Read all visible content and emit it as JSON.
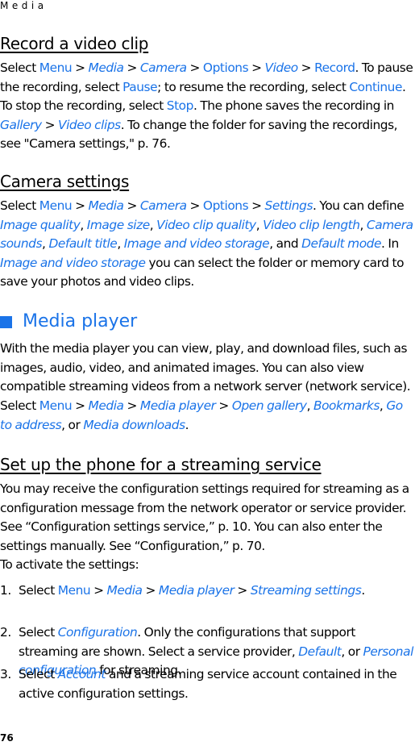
{
  "running_head": "Media",
  "page_number": "76",
  "colors": {
    "accent": "#1a73e8",
    "text": "#000000"
  },
  "sections": {
    "record": {
      "heading": "Record a video clip",
      "p1": [
        {
          "t": "Select ",
          "s": "n"
        },
        {
          "t": "Menu",
          "s": "b"
        },
        {
          "t": " > ",
          "s": "n"
        },
        {
          "t": "Media",
          "s": "i"
        },
        {
          "t": " > ",
          "s": "n"
        },
        {
          "t": "Camera",
          "s": "i"
        },
        {
          "t": " > ",
          "s": "n"
        },
        {
          "t": "Options",
          "s": "b"
        },
        {
          "t": " > ",
          "s": "n"
        },
        {
          "t": "Video",
          "s": "i"
        },
        {
          "t": " > ",
          "s": "n"
        },
        {
          "t": "Record",
          "s": "b"
        },
        {
          "t": ". To pause the recording, select ",
          "s": "n"
        },
        {
          "t": "Pause",
          "s": "b"
        },
        {
          "t": "; to resume the recording, select ",
          "s": "n"
        },
        {
          "t": "Continue",
          "s": "b"
        },
        {
          "t": ". To stop the recording, select ",
          "s": "n"
        },
        {
          "t": "Stop",
          "s": "b"
        },
        {
          "t": ". The phone saves the recording in ",
          "s": "n"
        },
        {
          "t": "Gallery",
          "s": "i"
        },
        {
          "t": " > ",
          "s": "n"
        },
        {
          "t": "Video clips",
          "s": "i"
        },
        {
          "t": ". To change the folder for saving the recordings, see \"Camera settings,\" p. 76.",
          "s": "n"
        }
      ]
    },
    "camera_settings": {
      "heading": "Camera settings",
      "p1": [
        {
          "t": "Select ",
          "s": "n"
        },
        {
          "t": "Menu",
          "s": "b"
        },
        {
          "t": " > ",
          "s": "n"
        },
        {
          "t": "Media",
          "s": "i"
        },
        {
          "t": " > ",
          "s": "n"
        },
        {
          "t": "Camera",
          "s": "i"
        },
        {
          "t": " > ",
          "s": "n"
        },
        {
          "t": "Options",
          "s": "b"
        },
        {
          "t": " > ",
          "s": "n"
        },
        {
          "t": "Settings",
          "s": "i"
        },
        {
          "t": ". You can define ",
          "s": "n"
        },
        {
          "t": "Image quality",
          "s": "i"
        },
        {
          "t": ", ",
          "s": "n"
        },
        {
          "t": "Image size",
          "s": "i"
        },
        {
          "t": ", ",
          "s": "n"
        },
        {
          "t": "Video clip quality",
          "s": "i"
        },
        {
          "t": ", ",
          "s": "n"
        },
        {
          "t": "Video clip length",
          "s": "i"
        },
        {
          "t": ", ",
          "s": "n"
        },
        {
          "t": "Camera sounds",
          "s": "i"
        },
        {
          "t": ", ",
          "s": "n"
        },
        {
          "t": "Default title",
          "s": "i"
        },
        {
          "t": ", ",
          "s": "n"
        },
        {
          "t": "Image and video storage",
          "s": "i"
        },
        {
          "t": ", and ",
          "s": "n"
        },
        {
          "t": "Default mode",
          "s": "i"
        },
        {
          "t": ". In ",
          "s": "n"
        },
        {
          "t": "Image and video storage",
          "s": "i"
        },
        {
          "t": " you can select the folder or memory card to save your photos and video clips.",
          "s": "n"
        }
      ]
    },
    "media_player": {
      "heading": "Media player",
      "p1": [
        {
          "t": "With the media player you can view, play, and download files, such as images, audio, video, and animated images. You can also view compatible streaming videos from a network server (network service).",
          "s": "n"
        }
      ],
      "p2": [
        {
          "t": "Select ",
          "s": "n"
        },
        {
          "t": "Menu",
          "s": "b"
        },
        {
          "t": " > ",
          "s": "n"
        },
        {
          "t": "Media",
          "s": "i"
        },
        {
          "t": " > ",
          "s": "n"
        },
        {
          "t": "Media player",
          "s": "i"
        },
        {
          "t": " > ",
          "s": "n"
        },
        {
          "t": "Open gallery",
          "s": "i"
        },
        {
          "t": ", ",
          "s": "n"
        },
        {
          "t": "Bookmarks",
          "s": "i"
        },
        {
          "t": ", ",
          "s": "n"
        },
        {
          "t": "Go to address",
          "s": "i"
        },
        {
          "t": ", or ",
          "s": "n"
        },
        {
          "t": "Media downloads",
          "s": "i"
        },
        {
          "t": ".",
          "s": "n"
        }
      ]
    },
    "streaming": {
      "heading": "Set up the phone for a streaming service",
      "p1": [
        {
          "t": "You may receive the configuration settings required for streaming as a configuration message from the network operator or service provider. See “Configuration settings service,” p. 10. You can also enter the settings manually. See “Configuration,” p. 70.",
          "s": "n"
        }
      ],
      "p2": [
        {
          "t": "To activate the settings:",
          "s": "n"
        }
      ],
      "steps": [
        {
          "num": "1.",
          "runs": [
            {
              "t": "Select ",
              "s": "n"
            },
            {
              "t": "Menu",
              "s": "b"
            },
            {
              "t": " > ",
              "s": "n"
            },
            {
              "t": "Media",
              "s": "i"
            },
            {
              "t": " > ",
              "s": "n"
            },
            {
              "t": "Media player",
              "s": "i"
            },
            {
              "t": " > ",
              "s": "n"
            },
            {
              "t": "Streaming settings",
              "s": "i"
            },
            {
              "t": ".",
              "s": "n"
            }
          ]
        },
        {
          "num": "2.",
          "runs": [
            {
              "t": "Select ",
              "s": "n"
            },
            {
              "t": "Configuration",
              "s": "i"
            },
            {
              "t": ". Only the configurations that support streaming are shown. Select a service provider, ",
              "s": "n"
            },
            {
              "t": "Default",
              "s": "i"
            },
            {
              "t": ", or ",
              "s": "n"
            },
            {
              "t": "Personal configuration",
              "s": "i"
            },
            {
              "t": " for streaming.",
              "s": "n"
            }
          ]
        },
        {
          "num": "3.",
          "runs": [
            {
              "t": "Select ",
              "s": "n"
            },
            {
              "t": "Account",
              "s": "i"
            },
            {
              "t": " and a streaming service account contained in the active configuration settings.",
              "s": "n"
            }
          ]
        }
      ]
    }
  }
}
